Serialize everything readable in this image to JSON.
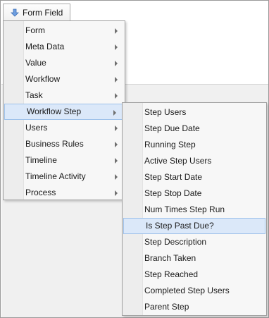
{
  "form_field_button": {
    "label": "Form Field",
    "icon": "down-arrow-icon"
  },
  "main_menu": {
    "items": [
      {
        "label": "Form",
        "has_submenu": true
      },
      {
        "label": "Meta Data",
        "has_submenu": true
      },
      {
        "label": "Value",
        "has_submenu": true
      },
      {
        "label": "Workflow",
        "has_submenu": true
      },
      {
        "label": "Task",
        "has_submenu": true
      },
      {
        "label": "Workflow Step",
        "has_submenu": true,
        "active": true
      },
      {
        "label": "Users",
        "has_submenu": true
      },
      {
        "label": "Business Rules",
        "has_submenu": true
      },
      {
        "label": "Timeline",
        "has_submenu": true
      },
      {
        "label": "Timeline Activity",
        "has_submenu": true
      },
      {
        "label": "Process",
        "has_submenu": true
      }
    ]
  },
  "sub_menu": {
    "items": [
      {
        "label": "Step Users"
      },
      {
        "label": "Step Due Date"
      },
      {
        "label": "Running Step"
      },
      {
        "label": "Active Step Users"
      },
      {
        "label": "Step Start Date"
      },
      {
        "label": "Step Stop Date"
      },
      {
        "label": "Num Times Step Run"
      },
      {
        "label": "Is Step Past Due?",
        "hovered": true
      },
      {
        "label": "Step Description"
      },
      {
        "label": "Branch Taken"
      },
      {
        "label": "Step Reached"
      },
      {
        "label": "Completed Step Users"
      },
      {
        "label": "Parent Step"
      }
    ]
  },
  "colors": {
    "highlight_bg": "#dbe8f9",
    "highlight_border": "#9ec1ea",
    "icon_blue": "#5b8fd6"
  }
}
